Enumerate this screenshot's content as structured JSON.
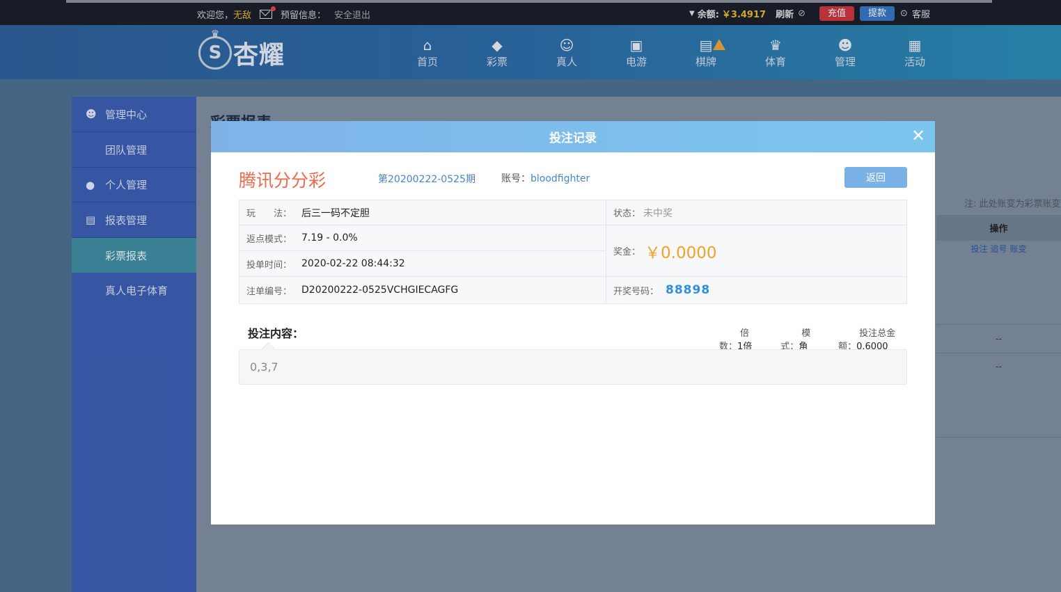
{
  "topbar": {
    "welcome": "欢迎您，",
    "username": "无敌",
    "message_label": "预留信息：",
    "logout": "安全退出",
    "balance_label": "余额:",
    "balance": "￥3.4917",
    "refresh": "刷新",
    "recharge": "充值",
    "withdraw": "提款",
    "service": "客服"
  },
  "header": {
    "logo_text": "杏耀",
    "nav": [
      {
        "label": "首页",
        "icon": "home-icon",
        "glyph": "⌂"
      },
      {
        "label": "彩票",
        "icon": "lottery-ticket-icon",
        "glyph": "◆"
      },
      {
        "label": "真人",
        "icon": "live-person-icon",
        "glyph": "☺"
      },
      {
        "label": "电游",
        "icon": "slot-machine-icon",
        "glyph": "▣"
      },
      {
        "label": "棋牌",
        "icon": "cards-icon",
        "glyph": "▤"
      },
      {
        "label": "体育",
        "icon": "trophy-icon",
        "glyph": "♛"
      },
      {
        "label": "管理",
        "icon": "users-icon",
        "glyph": "☻"
      },
      {
        "label": "活动",
        "icon": "gift-icon",
        "glyph": "▦"
      }
    ]
  },
  "sidebar": {
    "groups": [
      {
        "label": "管理中心",
        "icon": "users-icon"
      },
      {
        "label": "个人管理",
        "icon": "user-icon"
      },
      {
        "label": "报表管理",
        "icon": "document-icon"
      }
    ],
    "subs": [
      "团队管理",
      "彩票报表",
      "真人电子体育"
    ]
  },
  "background_page": {
    "title": "彩票报表",
    "note": "注: 此处账变为彩票账变",
    "ops_header": "操作",
    "ops": [
      "投注",
      "追号",
      "账变"
    ],
    "dash": "--"
  },
  "modal": {
    "title": "投注记录",
    "lottery_name": "腾讯分分彩",
    "period": "第20200222-0525期",
    "account_label": "账号：",
    "account": "bloodfighter",
    "back": "返回",
    "play_label": "玩　　法：",
    "play": "后三一码不定胆",
    "rebate_label": "返点模式：",
    "rebate": "7.19 - 0.0%",
    "time_label": "投单时间：",
    "time": "2020-02-22 08:44:32",
    "order_label": "注单编号：",
    "order": "D20200222-0525VCHGIECAGFG",
    "status_label": "状态：",
    "status": "未中奖",
    "prize_label": "奖金：",
    "prize": "￥0.0000",
    "draw_label": "开奖号码：",
    "draw": "88898",
    "bet_title": "投注内容：",
    "multiple_label": "倍数：",
    "multiple": "1倍",
    "mode_label": "模式：",
    "mode": "角",
    "total_label": "投注总金额：",
    "total": "0.6000",
    "bet_content": "0,3,7"
  },
  "colors": {
    "accent_red": "#e96a4e",
    "link_blue": "#4a84c6",
    "prize_orange": "#f0a12a",
    "draw_blue": "#2f8ed8",
    "balance_gold": "#e5b52b"
  }
}
